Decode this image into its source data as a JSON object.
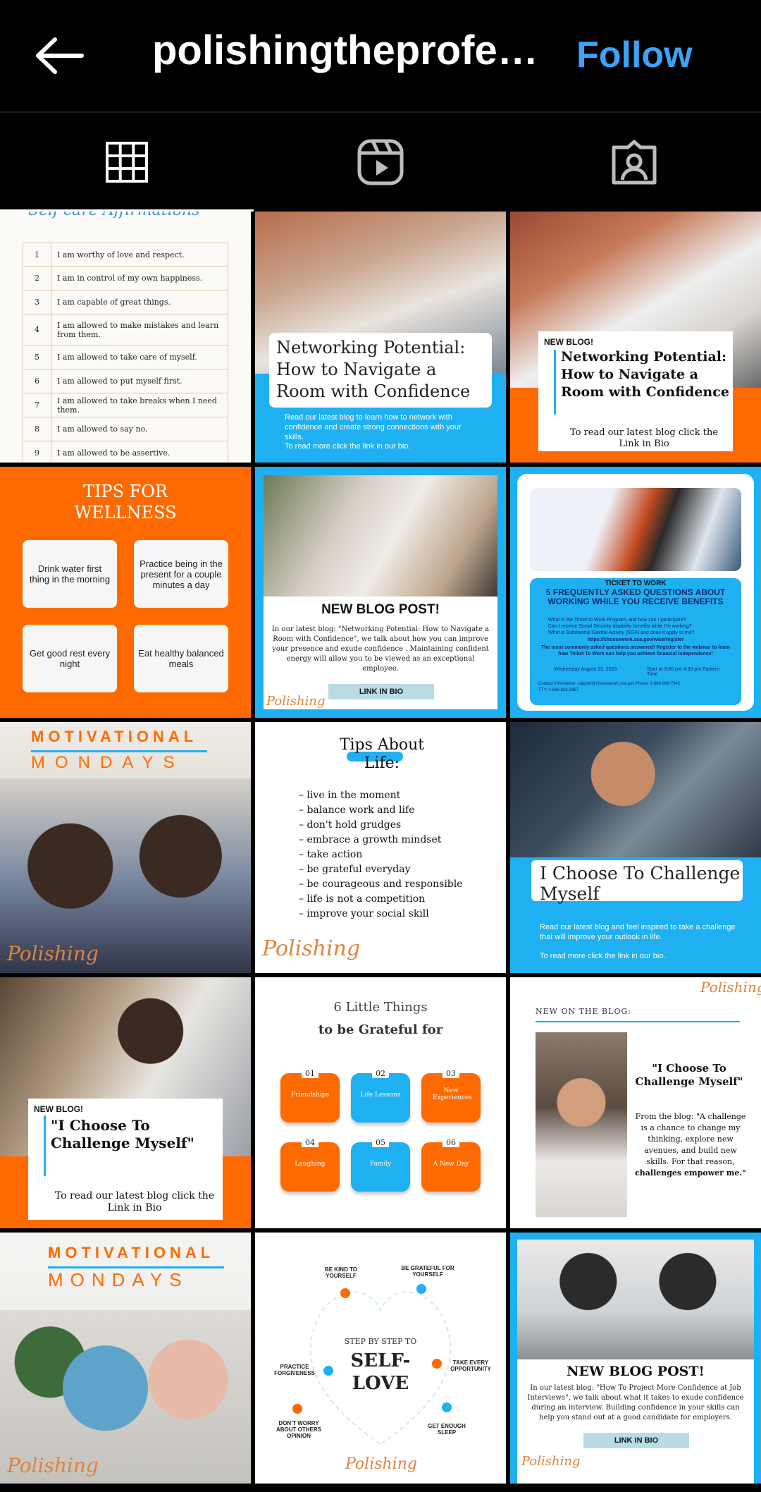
{
  "header": {
    "title": "polishingtheprofe…",
    "follow_label": "Follow"
  },
  "tabs": [
    {
      "icon": "grid-icon",
      "selected": true
    },
    {
      "icon": "reels-icon",
      "selected": false
    },
    {
      "icon": "tagged-icon",
      "selected": false
    }
  ],
  "posts": {
    "p1": {
      "heading": "Self-care Affirmations",
      "rows": [
        {
          "n": "1",
          "t": "I am worthy of love and respect."
        },
        {
          "n": "2",
          "t": "I am in control of my own happiness."
        },
        {
          "n": "3",
          "t": "I am capable of great things."
        },
        {
          "n": "4",
          "t": "I am allowed to make mistakes and learn from them."
        },
        {
          "n": "5",
          "t": "I am allowed to take care of myself."
        },
        {
          "n": "6",
          "t": "I am allowed to put myself first."
        },
        {
          "n": "7",
          "t": "I am allowed to take breaks when I need them."
        },
        {
          "n": "8",
          "t": "I am allowed to say no."
        },
        {
          "n": "9",
          "t": "I am allowed to be assertive."
        }
      ]
    },
    "p2": {
      "title": "Networking Potential: How to Navigate a Room with Confidence",
      "body": "Read our latest blog to learn how to network with confidence and create strong connections with your skills.",
      "cta": "To read more click the link in our bio."
    },
    "p3": {
      "tag": "NEW BLOG!",
      "title": "Networking Potential: How to Navigate a Room with Confidence",
      "cta": "To read our latest blog click the Link in Bio"
    },
    "p4": {
      "title": "TIPS FOR WELLNESS",
      "tips": [
        "Drink water first thing in the morning",
        "Practice being in the present for a couple minutes a day",
        "Get good rest every night",
        "Eat healthy balanced meals"
      ]
    },
    "p5": {
      "title": "NEW BLOG POST!",
      "body": "In our latest blog: \"Networking Potential: How to Navigate a Room with Confidence\", we talk about how you can improve your presence and exude confidence . Maintaining confident energy will allow you to be viewed as an exceptional employee.",
      "button": "LINK IN BIO",
      "logo": "Polishing"
    },
    "p6": {
      "kicker": "TICKET TO WORK",
      "title": "5 FREQUENTLY ASKED QUESTIONS ABOUT WORKING WHILE YOU RECEIVE BENEFITS",
      "bullets": [
        "What is the Ticket to Work Program, and how can I participate?",
        "Can I receive Social Security disability benefits while I'm working?",
        "What is Substantial Gainful Activity (SGA) and does it apply to me?"
      ],
      "url": "https://choosework.ssa.gov/wise/register",
      "note": "The most commonly asked questions answered! Register to the webinar to learn how Ticket To Work can help you achieve financial independence!",
      "date": "Wednesday August 23, 2023",
      "time": "Start at 3:00 pm 4:30 pm Eastern Time",
      "contact": "Contact Information: support@choosework.ssa.gov Phone: 1-866-968-7842 TTY: 1-866-833-2967"
    },
    "p7": {
      "line1": "MOTIVATIONAL",
      "line2": "MONDAYS",
      "logo": "Polishing"
    },
    "p8": {
      "title": "Tips About Life:",
      "items": [
        "live in the moment",
        "balance work and life",
        "don't hold grudges",
        "embrace a growth mindset",
        "take action",
        "be grateful everyday",
        "be courageous and responsible",
        "life is not a competition",
        "improve your social skill"
      ],
      "logo": "Polishing"
    },
    "p9": {
      "title": "I Choose To Challenge Myself",
      "body": "Read our latest blog and feel inspired to take a challenge that will improve your outlook in life.",
      "cta": "To read more click the link in our bio."
    },
    "p10": {
      "tag": "NEW BLOG!",
      "title": "\"I Choose To Challenge Myself\"",
      "cta": "To read our latest blog click the Link in Bio"
    },
    "p11": {
      "title1": "6 Little Things",
      "title2": "to be Grateful for",
      "items": [
        {
          "n": "01",
          "t": "Friendships"
        },
        {
          "n": "02",
          "t": "Life Lessons"
        },
        {
          "n": "03",
          "t": "New Experiences"
        },
        {
          "n": "04",
          "t": "Laughing"
        },
        {
          "n": "05",
          "t": "Family"
        },
        {
          "n": "06",
          "t": "A New Day"
        }
      ]
    },
    "p12": {
      "logo": "Polishing",
      "kicker": "NEW ON THE BLOG:",
      "title": "\"I Choose To Challenge Myself\"",
      "body1": "From the blog: \"A challenge is a chance to change my thinking, explore new avenues, and build new skills. For that reason,",
      "body2": "challenges empower me.\""
    },
    "p13": {
      "line1": "MOTIVATIONAL",
      "line2": "MONDAYS",
      "logo": "Polishing"
    },
    "p14": {
      "center1": "STEP BY STEP TO",
      "center2": "SELF-LOVE",
      "steps": [
        "BE KIND TO YOURSELF",
        "BE GRATEFUL FOR YOURSELF",
        "PRACTICE FORGIVENESS",
        "TAKE EVERY OPPORTUNITY",
        "DON'T WORRY ABOUT OTHERS OPINION",
        "GET ENOUGH SLEEP"
      ],
      "logo": "Polishing"
    },
    "p15": {
      "title": "NEW BLOG POST!",
      "body": "In our latest blog: \"How To Project More Confidence at Job Interviews\", we talk about what it takes to exude confidence during an interview. Building confidence in your skills can help you stand out at a good candidate for employers.",
      "button": "LINK IN BIO",
      "logo": "Polishing"
    }
  },
  "colors": {
    "orange": "#ff6a00",
    "blue": "#1fb0f2",
    "follow": "#3ea2f7"
  }
}
